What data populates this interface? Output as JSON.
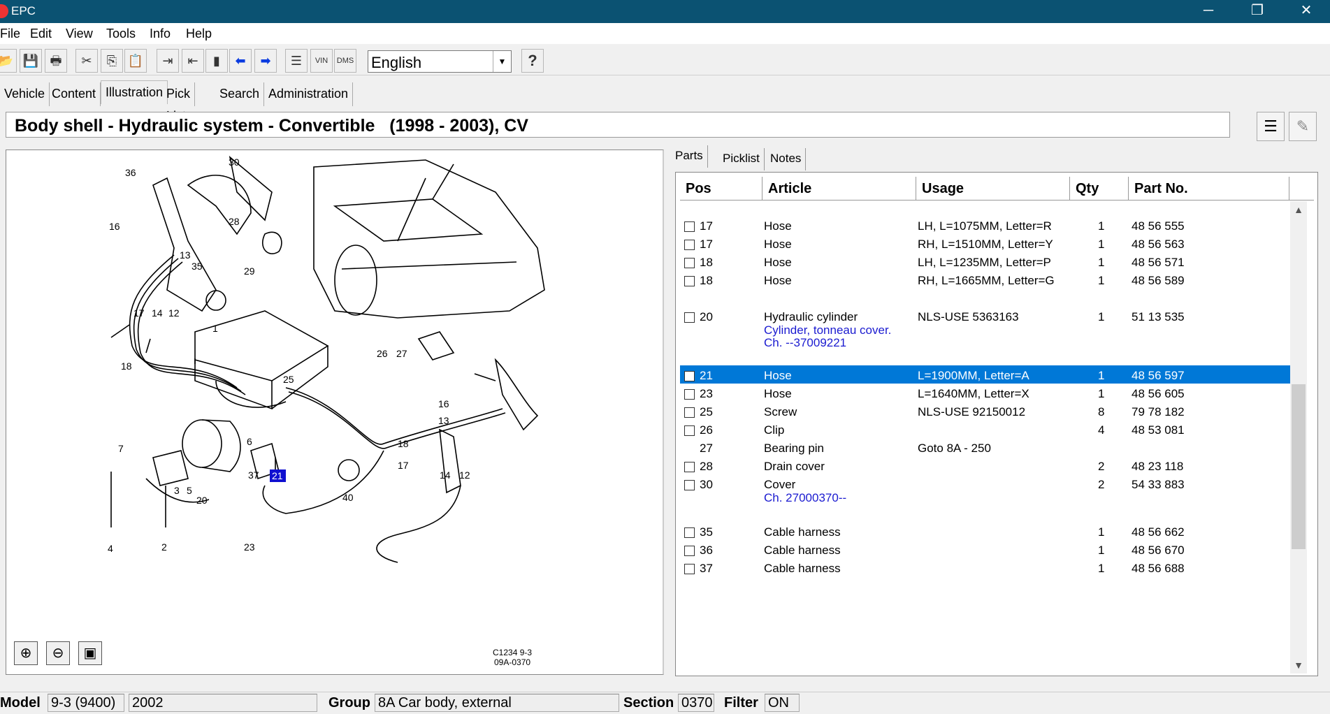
{
  "window": {
    "title": "EPC",
    "minimize": "─",
    "restore": "❐",
    "close": "✕"
  },
  "menu": [
    "File",
    "Edit",
    "View",
    "Tools",
    "Info",
    "Help"
  ],
  "toolbar": {
    "vin_label": "VIN",
    "dms_label": "DMS",
    "help_label": "?",
    "language": "English"
  },
  "tabs": [
    "Vehicle",
    "Content",
    "Illustration",
    "Pick List",
    "Search",
    "Administration"
  ],
  "header": {
    "title": "Body shell - Hydraulic system - Convertible   (1998 - 2003), CV"
  },
  "illustration": {
    "callouts": [
      "36",
      "30",
      "28",
      "16",
      "13",
      "35",
      "29",
      "17",
      "14",
      "12",
      "1",
      "18",
      "25",
      "26",
      "27",
      "16",
      "13",
      "18",
      "17",
      "14",
      "12",
      "7",
      "6",
      "37",
      "21",
      "3",
      "5",
      "20",
      "40",
      "4",
      "2",
      "23"
    ],
    "figure_id": "C1234 9-3\n09A-0370",
    "highlighted": "21"
  },
  "parts_tabs": [
    "Parts",
    "Picklist",
    "Notes"
  ],
  "parts_columns": [
    "Pos",
    "Article",
    "Usage",
    "Qty",
    "Part No."
  ],
  "parts_rows": [
    {
      "pos": "17",
      "article": "Hose",
      "usage": "LH, L=1075MM, Letter=R",
      "qty": "1",
      "partno": "48 56 555",
      "sub": []
    },
    {
      "pos": "17",
      "article": "Hose",
      "usage": "RH, L=1510MM, Letter=Y",
      "qty": "1",
      "partno": "48 56 563",
      "sub": []
    },
    {
      "pos": "18",
      "article": "Hose",
      "usage": "LH, L=1235MM, Letter=P",
      "qty": "1",
      "partno": "48 56 571",
      "sub": []
    },
    {
      "pos": "18",
      "article": "Hose",
      "usage": "RH, L=1665MM, Letter=G",
      "qty": "1",
      "partno": "48 56 589",
      "sub": []
    },
    {
      "pos": "20",
      "article": "Hydraulic cylinder",
      "usage": "NLS-USE 5363163",
      "qty": "1",
      "partno": "51 13 535",
      "sub": [
        "Cylinder, tonneau cover.",
        "Ch. --37009221"
      ]
    },
    {
      "pos": "21",
      "article": "Hose",
      "usage": "L=1900MM, Letter=A",
      "qty": "1",
      "partno": "48 56 597",
      "sub": [],
      "selected": true
    },
    {
      "pos": "23",
      "article": "Hose",
      "usage": "L=1640MM, Letter=X",
      "qty": "1",
      "partno": "48 56 605",
      "sub": []
    },
    {
      "pos": "25",
      "article": "Screw",
      "usage": "NLS-USE 92150012",
      "qty": "8",
      "partno": "79 78 182",
      "sub": []
    },
    {
      "pos": "26",
      "article": "Clip",
      "usage": "",
      "qty": "4",
      "partno": "48 53 081",
      "sub": []
    },
    {
      "pos": "27",
      "article": "Bearing pin",
      "usage": "Goto 8A - 250",
      "qty": "",
      "partno": "",
      "sub": [],
      "nocheck": true
    },
    {
      "pos": "28",
      "article": "Drain cover",
      "usage": "",
      "qty": "2",
      "partno": "48 23 118",
      "sub": []
    },
    {
      "pos": "30",
      "article": "Cover",
      "usage": "",
      "qty": "2",
      "partno": "54 33 883",
      "sub": [
        "Ch. 27000370--"
      ]
    },
    {
      "pos": "35",
      "article": "Cable harness",
      "usage": "",
      "qty": "1",
      "partno": "48 56 662",
      "sub": []
    },
    {
      "pos": "36",
      "article": "Cable harness",
      "usage": "",
      "qty": "1",
      "partno": "48 56 670",
      "sub": []
    },
    {
      "pos": "37",
      "article": "Cable harness",
      "usage": "",
      "qty": "1",
      "partno": "48 56 688",
      "sub": []
    }
  ],
  "status": {
    "model_label": "Model",
    "model": "9-3 (9400)",
    "year": "2002",
    "group_label": "Group",
    "group": "8A Car body, external",
    "section_label": "Section",
    "section": "0370",
    "filter_label": "Filter",
    "filter": "ON"
  },
  "colors": {
    "titlebar": "#0b5272",
    "selection": "#0078d7",
    "sub_text": "#1b1bd0",
    "callout_highlight": "#1010d0"
  }
}
